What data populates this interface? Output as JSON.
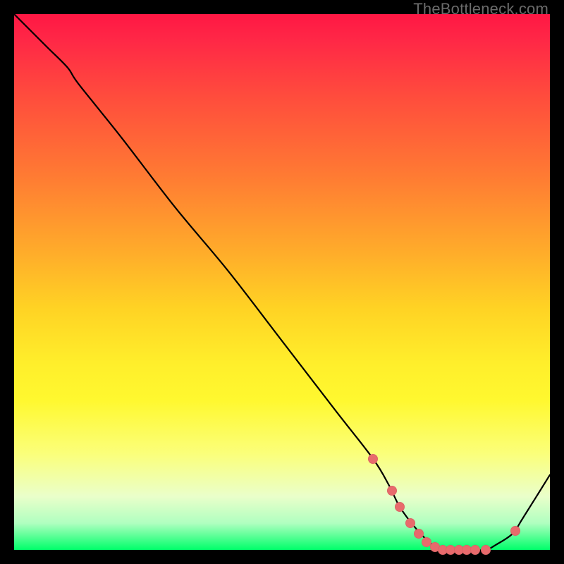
{
  "watermark": "TheBottleneck.com",
  "chart_data": {
    "type": "line",
    "title": "",
    "xlabel": "",
    "ylabel": "",
    "xlim": [
      0,
      100
    ],
    "ylim": [
      0,
      100
    ],
    "grid": false,
    "series": [
      {
        "name": "bottleneck-curve",
        "x": [
          0,
          6,
          10,
          12,
          20,
          30,
          40,
          50,
          60,
          67,
          70,
          72,
          75,
          78,
          80,
          83,
          85,
          88,
          90,
          93,
          95,
          100
        ],
        "values": [
          100,
          94,
          90,
          87,
          77,
          64,
          52,
          39,
          26,
          17,
          12,
          8,
          4,
          1,
          0,
          0,
          0,
          0,
          1,
          3,
          6,
          14
        ]
      }
    ],
    "markers": {
      "name": "highlight-points",
      "x": [
        67,
        70.5,
        72,
        74,
        75.5,
        77,
        78.5,
        80,
        81.5,
        83,
        84.5,
        86,
        88,
        93.5
      ],
      "values": [
        17,
        11,
        8,
        5,
        3,
        1.5,
        0.5,
        0,
        0,
        0,
        0,
        0,
        0,
        3.5
      ]
    },
    "background_gradient": {
      "top": "#ff1744",
      "bottom": "#00ff6a"
    }
  }
}
